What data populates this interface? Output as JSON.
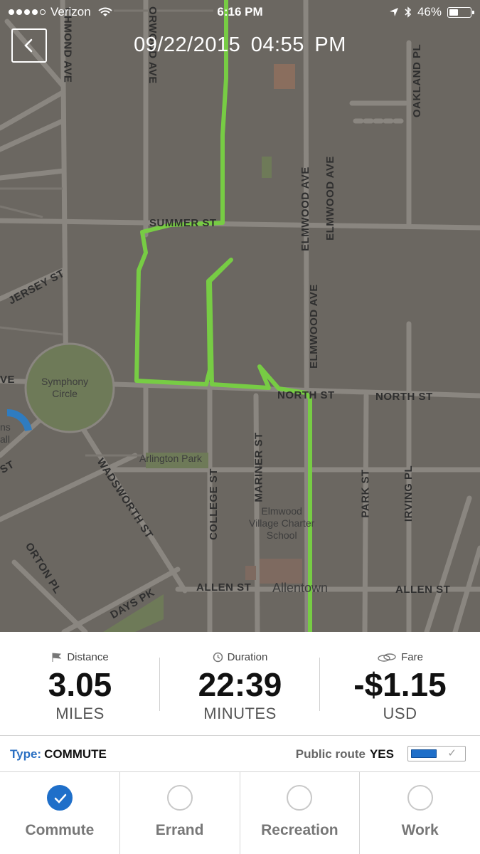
{
  "status_bar": {
    "carrier": "Verizon",
    "time": "6:16 PM",
    "battery": "46%",
    "battery_level": 0.46,
    "signal_bars_filled": 4,
    "signal_bars_total": 5
  },
  "header": {
    "date": "09/22/2015",
    "time": "04:55 PM"
  },
  "map": {
    "route_color": "#77cc44",
    "streets": {
      "summer": "SUMMER ST",
      "jersey": "JERSEY ST",
      "elmwood_1": "ELMWOOD AVE",
      "elmwood_2": "ELMWOOD AVE",
      "elmwood_3": "ELMWOOD AVE",
      "oakland": "OAKLAND PL",
      "richmond": "CHMOND AVE",
      "norwood": "ORWOOD AVE",
      "north_1": "NORTH ST",
      "north_2": "NORTH ST",
      "wadsworth": "WADSWORTH ST",
      "college": "COLLEGE ST",
      "mariner": "MARINER ST",
      "park": "PARK ST",
      "irving": "IRVING PL",
      "orton": "ORTON PL",
      "allen_1": "ALLEN ST",
      "allen_2": "ALLEN ST",
      "days": "DAYS PK",
      "ve_left": "VE",
      "st_left": "ST"
    },
    "places": {
      "symphony_1": "Symphony",
      "symphony_2": "Circle",
      "arlington": "Arlington Park",
      "elmwood_1": "Elmwood",
      "elmwood_2": "Village Charter",
      "elmwood_3": "School",
      "allentown": "Allentown",
      "hall_1": "ns",
      "hall_2": "all"
    }
  },
  "stats": {
    "distance": {
      "label": "Distance",
      "value": "3.05",
      "unit": "MILES"
    },
    "duration": {
      "label": "Duration",
      "value": "22:39",
      "unit": "MINUTES"
    },
    "fare": {
      "label": "Fare",
      "value": "-$1.15",
      "unit": "USD"
    }
  },
  "type_bar": {
    "type_key": "Type:",
    "type_value": "COMMUTE",
    "public_route_label": "Public route",
    "public_route_value": "YES"
  },
  "trip_types": [
    {
      "label": "Commute",
      "selected": true
    },
    {
      "label": "Errand",
      "selected": false
    },
    {
      "label": "Recreation",
      "selected": false
    },
    {
      "label": "Work",
      "selected": false
    }
  ],
  "colors": {
    "accent": "#1f6fc9",
    "type_key": "#2a6fc2",
    "map_background": "#6b6761"
  }
}
